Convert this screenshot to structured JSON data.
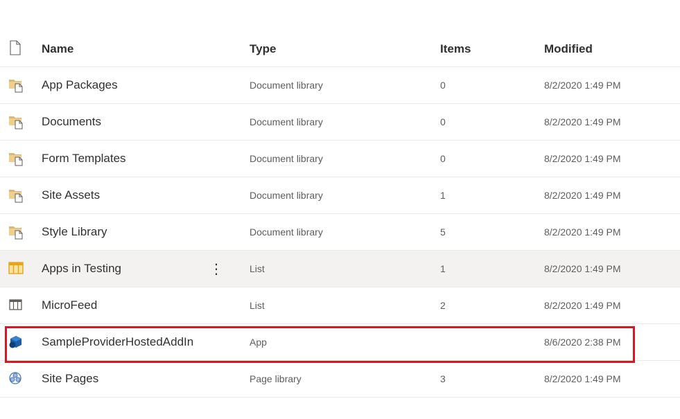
{
  "header": {
    "name": "Name",
    "type": "Type",
    "items": "Items",
    "modified": "Modified"
  },
  "rows": [
    {
      "icon": "document-library-icon",
      "name": "App Packages",
      "type": "Document library",
      "items": "0",
      "modified": "8/2/2020 1:49 PM"
    },
    {
      "icon": "document-library-icon",
      "name": "Documents",
      "type": "Document library",
      "items": "0",
      "modified": "8/2/2020 1:49 PM"
    },
    {
      "icon": "document-library-icon",
      "name": "Form Templates",
      "type": "Document library",
      "items": "0",
      "modified": "8/2/2020 1:49 PM"
    },
    {
      "icon": "document-library-icon",
      "name": "Site Assets",
      "type": "Document library",
      "items": "1",
      "modified": "8/2/2020 1:49 PM"
    },
    {
      "icon": "document-library-icon",
      "name": "Style Library",
      "type": "Document library",
      "items": "5",
      "modified": "8/2/2020 1:49 PM"
    },
    {
      "icon": "list-icon-highlighted",
      "name": "Apps in Testing",
      "type": "List",
      "items": "1",
      "modified": "8/2/2020 1:49 PM",
      "more": "⋮"
    },
    {
      "icon": "list-icon",
      "name": "MicroFeed",
      "type": "List",
      "items": "2",
      "modified": "8/2/2020 1:49 PM"
    },
    {
      "icon": "app-icon",
      "name": "SampleProviderHostedAddIn",
      "type": "App",
      "items": "",
      "modified": "8/6/2020 2:38 PM"
    },
    {
      "icon": "page-library-icon",
      "name": "Site Pages",
      "type": "Page library",
      "items": "3",
      "modified": "8/2/2020 1:49 PM"
    }
  ],
  "colors": {
    "folder": "#dcb67a",
    "list_highlight": "#e8a317",
    "app": "#1b5ea8",
    "highlight_border": "#e0141f"
  }
}
